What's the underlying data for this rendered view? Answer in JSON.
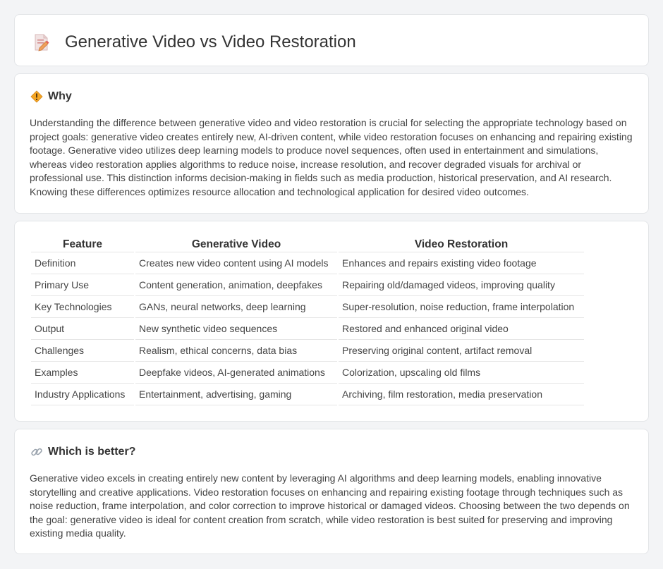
{
  "header": {
    "title": "Generative Video vs Video Restoration",
    "icon": "document-edit-icon"
  },
  "why": {
    "heading": "Why",
    "icon": "warning-diamond-icon",
    "text": "Understanding the difference between generative video and video restoration is crucial for selecting the appropriate technology based on project goals: generative video creates entirely new, AI-driven content, while video restoration focuses on enhancing and repairing existing footage. Generative video utilizes deep learning models to produce novel sequences, often used in entertainment and simulations, whereas video restoration applies algorithms to reduce noise, increase resolution, and recover degraded visuals for archival or professional use. This distinction informs decision-making in fields such as media production, historical preservation, and AI research. Knowing these differences optimizes resource allocation and technological application for desired video outcomes."
  },
  "table": {
    "headers": [
      "Feature",
      "Generative Video",
      "Video Restoration"
    ],
    "rows": [
      [
        "Definition",
        "Creates new video content using AI models",
        "Enhances and repairs existing video footage"
      ],
      [
        "Primary Use",
        "Content generation, animation, deepfakes",
        "Repairing old/damaged videos, improving quality"
      ],
      [
        "Key Technologies",
        "GANs, neural networks, deep learning",
        "Super-resolution, noise reduction, frame interpolation"
      ],
      [
        "Output",
        "New synthetic video sequences",
        "Restored and enhanced original video"
      ],
      [
        "Challenges",
        "Realism, ethical concerns, data bias",
        "Preserving original content, artifact removal"
      ],
      [
        "Examples",
        "Deepfake videos, AI-generated animations",
        "Colorization, upscaling old films"
      ],
      [
        "Industry Applications",
        "Entertainment, advertising, gaming",
        "Archiving, film restoration, media preservation"
      ]
    ]
  },
  "better": {
    "heading": "Which is better?",
    "icon": "link-icon",
    "text": "Generative video excels in creating entirely new content by leveraging AI algorithms and deep learning models, enabling innovative storytelling and creative applications. Video restoration focuses on enhancing and repairing existing footage through techniques such as noise reduction, frame interpolation, and color correction to improve historical or damaged videos. Choosing between the two depends on the goal: generative video is ideal for content creation from scratch, while video restoration is best suited for preserving and improving existing media quality."
  }
}
